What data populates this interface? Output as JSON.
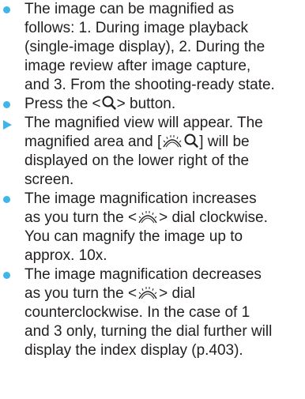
{
  "colors": {
    "bullet": "#3fb6e7",
    "text": "#231f20"
  },
  "icons": {
    "magnify": "magnifying-glass-icon",
    "dial": "main-dial-icon"
  },
  "items": [
    {
      "bullet": "dot",
      "lines": [
        "The image can be magnified as",
        "follows: 1. During image playback",
        "(single-image display), 2. During the",
        "image review after image capture,",
        "and 3. From the shooting-ready state."
      ]
    },
    {
      "bullet": "dot",
      "line_a": "Press the <",
      "line_b": "> button."
    },
    {
      "bullet": "triangle",
      "line1": "The magnified view will appear. The",
      "line2_a": "magnified area and [",
      "line2_b": "] will be",
      "line3": "displayed on the lower right of the",
      "line4": "screen."
    },
    {
      "bullet": "dot",
      "line1_a": "The image magnification increases",
      "line2_a": "as you turn the <",
      "line2_b": "> dial clockwise.",
      "line3": "You can magnify the image up to",
      "line4": "approx. 10x."
    },
    {
      "bullet": "dot",
      "line1": "The image magnification decreases",
      "line2_a": "as you turn the <",
      "line2_b": "> dial",
      "line3": "counterclockwise. In the case of 1",
      "line4": "and 3 only, turning the dial further will",
      "line5": "display the index display (p.403)."
    }
  ]
}
